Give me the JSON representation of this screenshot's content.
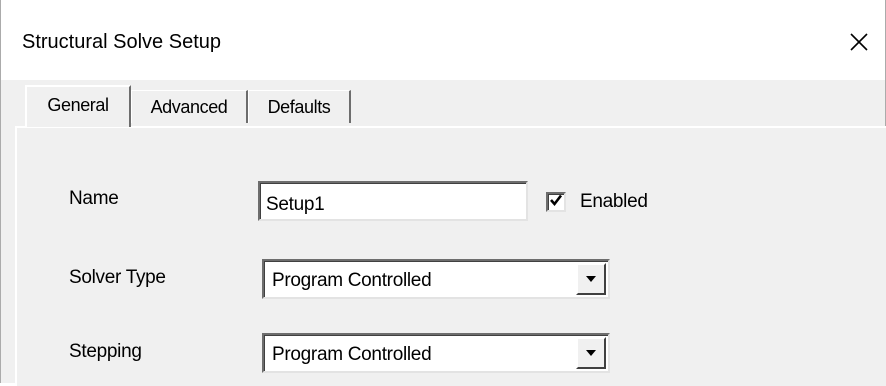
{
  "window": {
    "title": "Structural Solve Setup",
    "close_icon": "close-icon"
  },
  "tabs": [
    {
      "label": "General",
      "active": true
    },
    {
      "label": "Advanced",
      "active": false
    },
    {
      "label": "Defaults",
      "active": false
    }
  ],
  "general": {
    "name_label": "Name",
    "name_value": "Setup1",
    "enabled_label": "Enabled",
    "enabled_checked": true,
    "solver_type_label": "Solver Type",
    "solver_type_value": "Program Controlled",
    "stepping_label": "Stepping",
    "stepping_value": "Program Controlled"
  },
  "colors": {
    "dialog_bg": "#f0f0f0",
    "titlebar_bg": "#ffffff",
    "field_bg": "#ffffff"
  }
}
